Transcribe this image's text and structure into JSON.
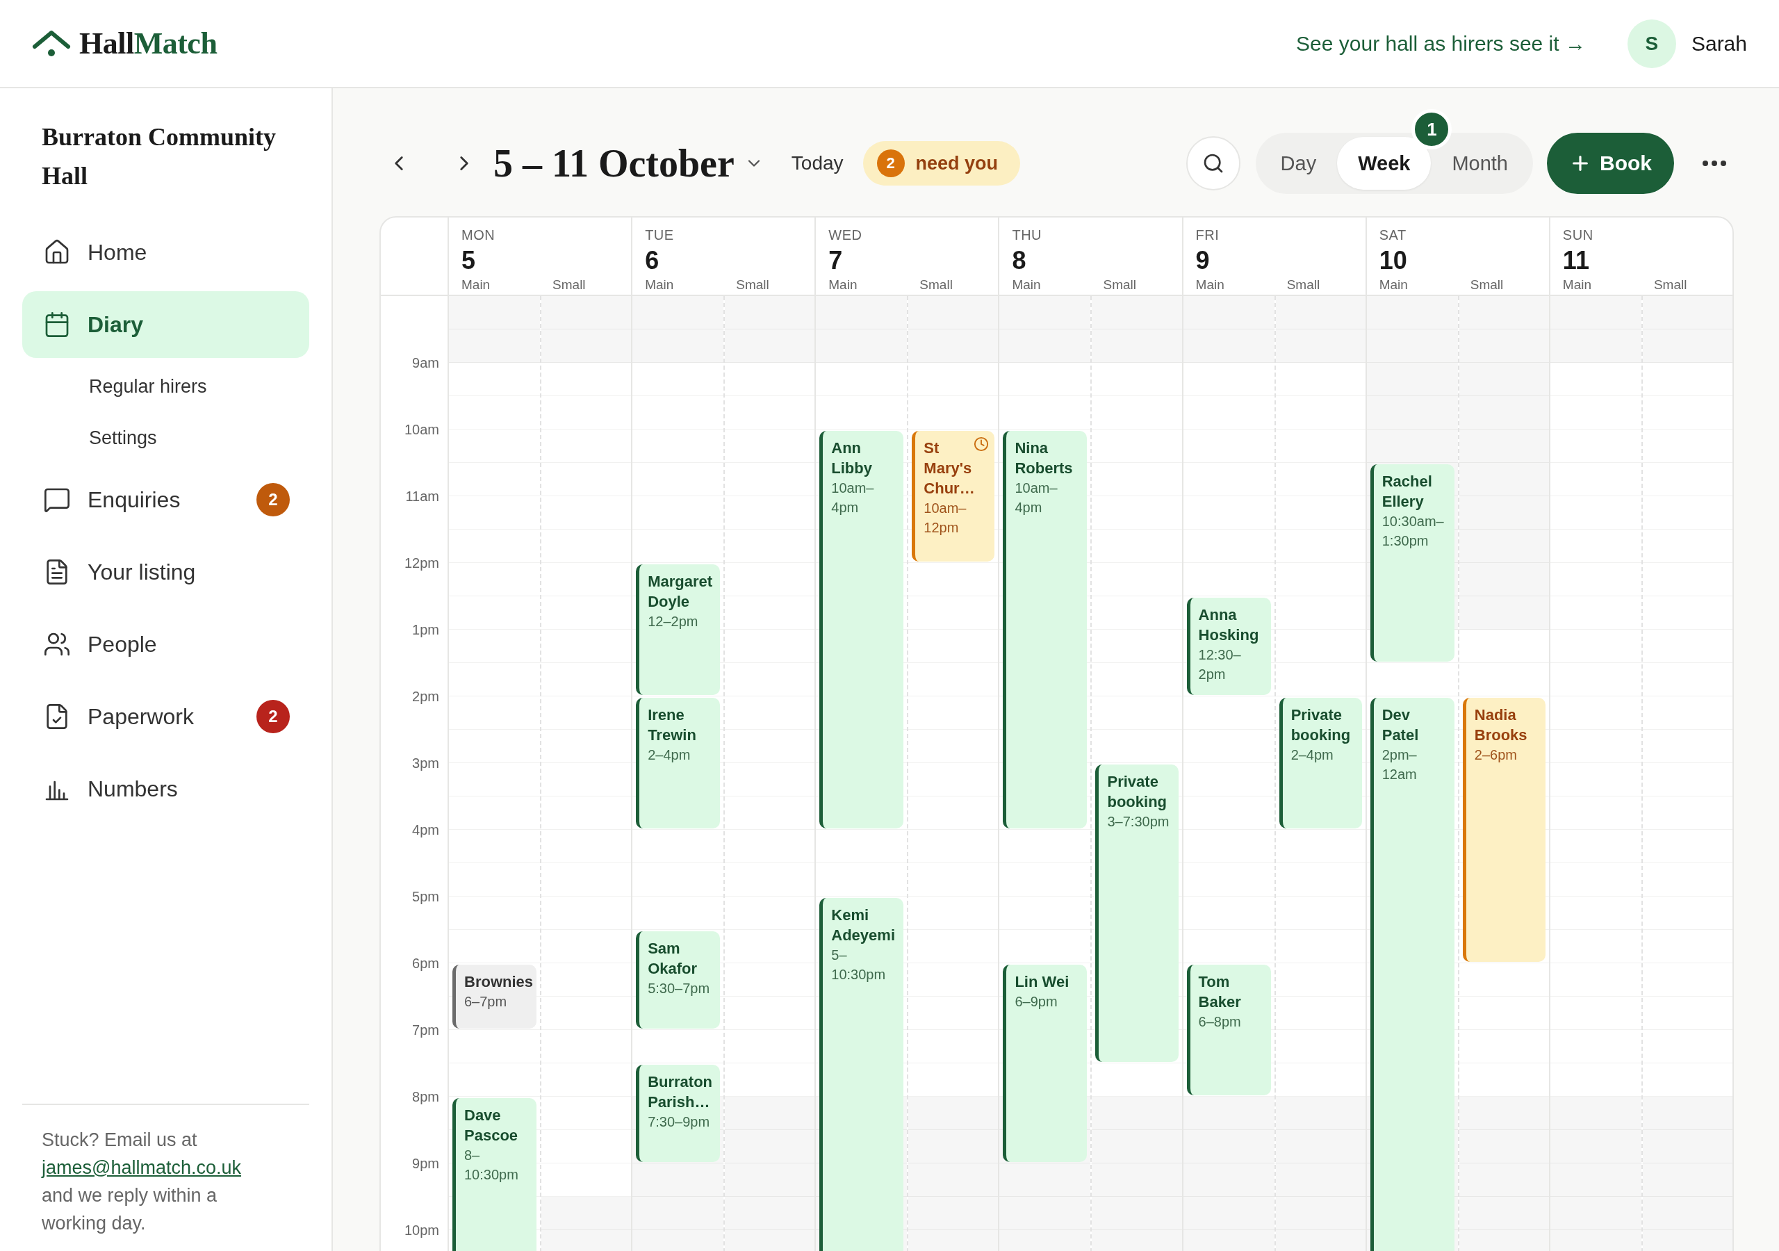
{
  "brand": {
    "parts": [
      "Hall",
      "Match"
    ]
  },
  "top_link": "See your hall as hirers see it →",
  "user": {
    "initial": "S",
    "name": "Sarah"
  },
  "sidebar": {
    "hall_name": "Burraton Community Hall",
    "items": [
      {
        "label": "Home",
        "selected": false
      },
      {
        "label": "Diary",
        "selected": true,
        "children": [
          {
            "label": "Regular hirers",
            "selected": false
          },
          {
            "label": "Settings",
            "selected": false
          }
        ]
      },
      {
        "label": "Enquiries",
        "selected": false,
        "badge": {
          "text": "2",
          "color": "#bf5a0c"
        }
      },
      {
        "label": "Your listing",
        "selected": false
      },
      {
        "label": "People",
        "selected": false
      },
      {
        "label": "Paperwork",
        "selected": false,
        "badge": {
          "text": "2",
          "color": "#b8231c"
        }
      },
      {
        "label": "Numbers",
        "selected": false
      }
    ],
    "help": {
      "before": "Stuck? Email us at",
      "email": "james@hallmatch.co.uk",
      "after": "and we reply within a working day."
    }
  },
  "toolbar": {
    "title": "5 – 11 October",
    "today": "Today",
    "attention": {
      "count": "2",
      "label": "need you"
    },
    "views": [
      {
        "label": "Day",
        "selected": false
      },
      {
        "label": "Week",
        "selected": true,
        "badge": "1"
      },
      {
        "label": "Month",
        "selected": false
      }
    ],
    "book": "Book"
  },
  "calendar": {
    "time_labels": [
      "9am",
      "10am",
      "11am",
      "12pm",
      "1pm",
      "2pm",
      "3pm",
      "4pm",
      "5pm",
      "6pm",
      "7pm",
      "8pm",
      "9pm",
      "10pm"
    ],
    "days": [
      {
        "abbr": "MON",
        "date": "5",
        "rooms": [
          {
            "label": "Main",
            "kind": "late",
            "events": [
              {
                "name": "Brownies",
                "time": "6–7pm",
                "kind": "hold",
                "awaiting": false
              },
              {
                "name": "Dave Pascoe",
                "time": "8–10:30pm",
                "kind": "confirmed",
                "awaiting": false
              }
            ]
          },
          {
            "label": "Small",
            "kind": "extended"
          }
        ]
      },
      {
        "abbr": "TUE",
        "date": "6",
        "rooms": [
          {
            "label": "Main",
            "kind": "standard",
            "events": [
              {
                "name": "Margaret Doyle",
                "time": "12–2pm",
                "kind": "confirmed",
                "awaiting": false
              },
              {
                "name": "Irene Trewin",
                "time": "2–4pm",
                "kind": "confirmed",
                "awaiting": false
              },
              {
                "name": "Sam Okafor",
                "time": "5:30–7pm",
                "kind": "confirmed",
                "awaiting": false
              },
              {
                "name": "Burraton Parish…",
                "time": "7:30–9pm",
                "kind": "confirmed",
                "awaiting": false
              }
            ]
          },
          {
            "label": "Small",
            "kind": "standard"
          }
        ]
      },
      {
        "abbr": "WED",
        "date": "7",
        "rooms": [
          {
            "label": "Main",
            "kind": "standard",
            "events": [
              {
                "name": "Ann Libby",
                "time": "10am–4pm",
                "kind": "confirmed",
                "awaiting": false
              },
              {
                "name": "Kemi Adeyemi",
                "time": "5–10:30pm",
                "kind": "confirmed",
                "awaiting": false
              }
            ]
          },
          {
            "label": "Small",
            "kind": "standard",
            "events": [
              {
                "name": "St Mary's Chur…",
                "time": "10am–12pm",
                "kind": "provisional",
                "awaiting": true
              }
            ]
          }
        ]
      },
      {
        "abbr": "THU",
        "date": "8",
        "rooms": [
          {
            "label": "Main",
            "kind": "standard",
            "events": [
              {
                "name": "Nina Roberts",
                "time": "10am–4pm",
                "kind": "confirmed",
                "awaiting": false
              },
              {
                "name": "Lin Wei",
                "time": "6–9pm",
                "kind": "confirmed",
                "awaiting": false
              }
            ]
          },
          {
            "label": "Small",
            "kind": "standard",
            "events": [
              {
                "name": "Private booking",
                "time": "3–7:30pm",
                "kind": "confirmed",
                "awaiting": false
              }
            ]
          }
        ]
      },
      {
        "abbr": "FRI",
        "date": "9",
        "rooms": [
          {
            "label": "Main",
            "kind": "standard",
            "events": [
              {
                "name": "Anna Hosking",
                "time": "12:30–2pm",
                "kind": "confirmed",
                "awaiting": false
              },
              {
                "name": "Tom Baker",
                "time": "6–8pm",
                "kind": "confirmed",
                "awaiting": false
              }
            ]
          },
          {
            "label": "Small",
            "kind": "standard",
            "events": [
              {
                "name": "Private booking",
                "time": "2–4pm",
                "kind": "confirmed",
                "awaiting": false
              }
            ]
          }
        ]
      },
      {
        "abbr": "SAT",
        "date": "10",
        "rooms": [
          {
            "label": "Main",
            "kind": "afternoon",
            "events": [
              {
                "name": "Rachel Ellery",
                "time": "10:30am–1:30pm",
                "kind": "confirmed",
                "awaiting": false
              },
              {
                "name": "Dev Patel",
                "time": "2pm–12am",
                "kind": "confirmed",
                "awaiting": false
              }
            ]
          },
          {
            "label": "Small",
            "kind": "afternoon",
            "events": [
              {
                "name": "Nadia Brooks",
                "time": "2–6pm",
                "kind": "provisional",
                "awaiting": false
              }
            ]
          }
        ]
      },
      {
        "abbr": "SUN",
        "date": "11",
        "rooms": [
          {
            "label": "Main",
            "kind": "standard"
          },
          {
            "label": "Small",
            "kind": "standard"
          }
        ]
      }
    ]
  }
}
